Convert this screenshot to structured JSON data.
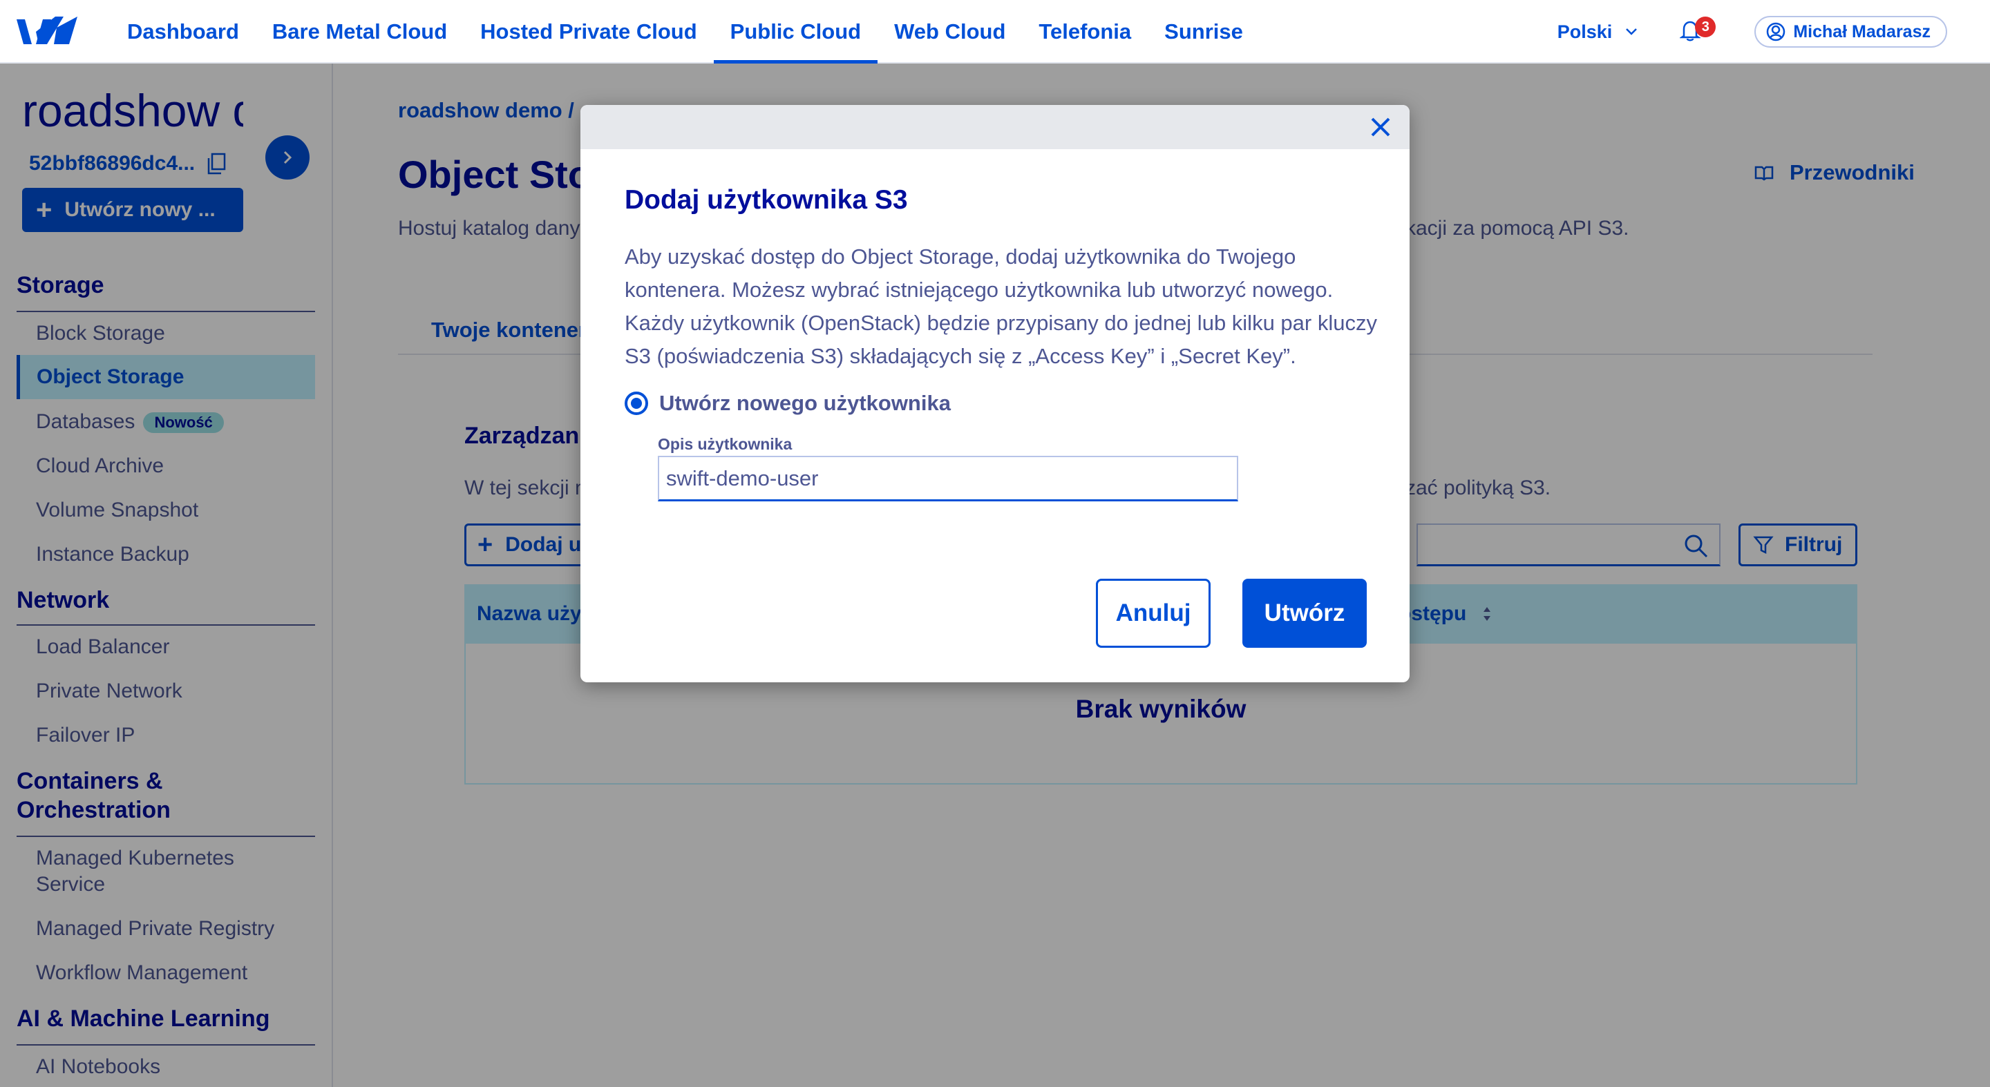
{
  "nav": {
    "items": [
      "Dashboard",
      "Bare Metal Cloud",
      "Hosted Private Cloud",
      "Public Cloud",
      "Web Cloud",
      "Telefonia",
      "Sunrise"
    ],
    "active_index": 3,
    "language": "Polski",
    "notifications_count": "3",
    "user_name": "Michał Madarasz"
  },
  "sidebar": {
    "project_name": "roadshow demo",
    "project_id": "52bbf86896dc4...",
    "create_button": "Utwórz nowy ...",
    "sections": {
      "storage": {
        "title": "Storage",
        "items": [
          "Block Storage",
          "Object Storage",
          "Databases",
          "Cloud Archive",
          "Volume Snapshot",
          "Instance Backup"
        ]
      },
      "network": {
        "title": "Network",
        "items": [
          "Load Balancer",
          "Private Network",
          "Failover IP"
        ]
      },
      "containers": {
        "title_line1": "Containers &",
        "title_line2": "Orchestration",
        "items": [
          "Managed Kubernetes",
          "Service",
          "Managed Private Registry",
          "Workflow Management"
        ]
      },
      "ai": {
        "title": "AI & Machine Learning",
        "items": [
          "AI Notebooks"
        ]
      }
    },
    "new_badge": "Nowość",
    "active_item": "Object Storage"
  },
  "main": {
    "breadcrumb": "roadshow demo /",
    "title": "Object Sto",
    "guides": "Przewodniki",
    "description": "Hostuj katalog dany",
    "description_end": "kacji za pomocą API S3.",
    "tab": "Twoje kontener",
    "section_title": "Zarządzani",
    "section_desc": "W tej sekcji n",
    "section_desc_end": "zać polityką S3.",
    "add_user_button": "Dodaj u",
    "filter_button": "Filtruj",
    "table": {
      "col_name": "Nazwa uży",
      "col_access": "ostępu",
      "empty": "Brak wyników"
    }
  },
  "modal": {
    "title": "Dodaj użytkownika S3",
    "text": "Aby uzyskać dostęp do Object Storage, dodaj użytkownika do Twojego kontenera. Możesz wybrać istniejącego użytkownika lub utworzyć nowego. Każdy użytkownik (OpenStack) będzie przypisany do jednej lub kilku par kluczy S3 (poświadczenia S3) składających się z „Access Key” i „Secret Key”.",
    "radio_label": "Utwórz nowego użytkownika",
    "field_label": "Opis użytkownika",
    "field_value": "swift-demo-user",
    "cancel": "Anuluj",
    "create": "Utwórz"
  },
  "colors": {
    "primary": "#0050d7",
    "dark_text": "#000e9c",
    "muted_text": "#4d5693",
    "active_bg": "#bef1ff",
    "badge_red": "#e02a2a"
  }
}
